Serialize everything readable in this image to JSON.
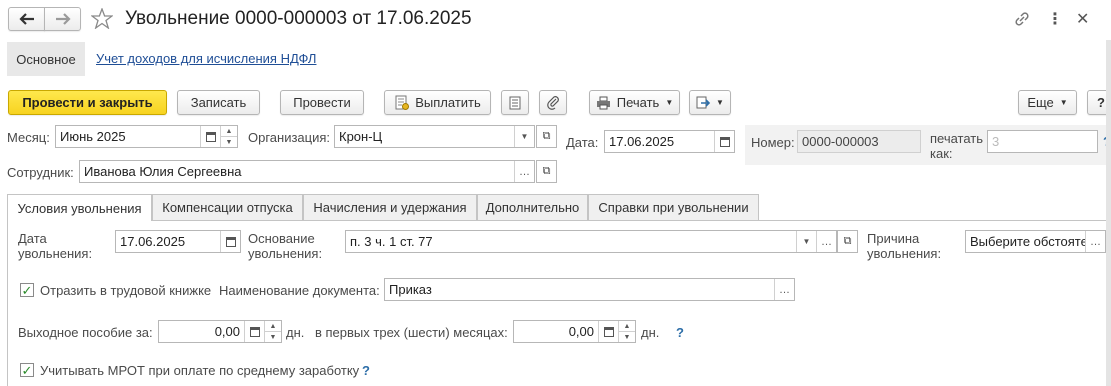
{
  "window": {
    "title": "Увольнение 0000-000003 от 17.06.2025"
  },
  "nav": {
    "basic": "Основное",
    "link": "Учет доходов для исчисления НДФЛ"
  },
  "toolbar": {
    "post_close": "Провести и закрыть",
    "write": "Записать",
    "post": "Провести",
    "pay": "Выплатить",
    "print": "Печать",
    "more": "Еще",
    "help": "?"
  },
  "header": {
    "month_label": "Месяц:",
    "month_value": "Июнь 2025",
    "org_label": "Организация:",
    "org_value": "Крон-Ц",
    "date_label": "Дата:",
    "date_value": "17.06.2025",
    "number_label": "Номер:",
    "number_value": "0000-000003",
    "print_as_label_1": "печатать",
    "print_as_label_2": "как:",
    "print_as_placeholder": "3",
    "print_as_help": "?",
    "employee_label": "Сотрудник:",
    "employee_value": "Иванова Юлия Сергеевна"
  },
  "tabs": [
    {
      "label": "Условия увольнения"
    },
    {
      "label": "Компенсации отпуска"
    },
    {
      "label": "Начисления и удержания"
    },
    {
      "label": "Дополнительно"
    },
    {
      "label": "Справки при увольнении"
    }
  ],
  "conditions": {
    "dismissal_date_label_1": "Дата",
    "dismissal_date_label_2": "увольнения:",
    "dismissal_date_value": "17.06.2025",
    "basis_label_1": "Основание",
    "basis_label_2": "увольнения:",
    "basis_value": "п. 3 ч. 1 ст. 77",
    "reason_label_1": "Причина",
    "reason_label_2": "увольнения:",
    "reason_value": "Выберите обстояте",
    "workbook_label": "Отразить в трудовой книжке",
    "workbook_checked": true,
    "doc_name_label": "Наименование документа:",
    "doc_name_value": "Приказ",
    "severance_label": "Выходное пособие за:",
    "severance_value": "0,00",
    "days_unit": "дн.",
    "first_months_label": "в первых трех (шести) месяцах:",
    "first_months_value": "0,00",
    "days_unit_2": "дн.",
    "help_mark": "?",
    "mrot_label": "Учитывать МРОТ при оплате по среднему заработку",
    "mrot_checked": true,
    "mrot_help": "?"
  },
  "colors": {
    "primary_button": "#f7d320",
    "link": "#1f4e96",
    "help": "#2d6ea8",
    "check": "#2a8a2a"
  }
}
